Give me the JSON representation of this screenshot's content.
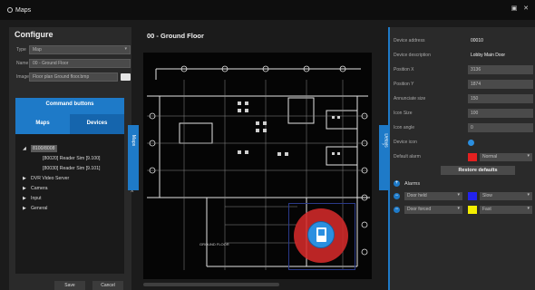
{
  "window": {
    "title": "Maps",
    "controls": [
      "restore-icon",
      "close-icon"
    ]
  },
  "configure": {
    "title": "Configure",
    "fields": [
      {
        "label": "Type",
        "value": "Map"
      },
      {
        "label": "Name",
        "value": "00 - Ground Floor"
      },
      {
        "label": "Image",
        "value": "Floor plan Ground floor.bmp"
      }
    ],
    "command_buttons_title": "Command buttons",
    "tabs": [
      "Maps",
      "Devices"
    ],
    "active_tab": "Devices",
    "tree": [
      {
        "label": "8100/8008",
        "level": 0,
        "expanded": true,
        "selected": true
      },
      {
        "label": "[80020] Reader Sim [9.100]",
        "level": 1
      },
      {
        "label": "[80030] Reader Sim [9.101]",
        "level": 1
      },
      {
        "label": "DVR Video Server",
        "level": 0,
        "expanded": false
      },
      {
        "label": "Camera",
        "level": 0,
        "expanded": false
      },
      {
        "label": "Input",
        "level": 0,
        "expanded": false
      },
      {
        "label": "General",
        "level": 0,
        "expanded": false
      }
    ],
    "save_label": "Save",
    "cancel_label": "Cancel",
    "maps_tab_label": "Maps"
  },
  "map": {
    "title": "00 - Ground Floor",
    "room_label": "GROUND FLOOR"
  },
  "details": {
    "tab_label": "Details",
    "rows": [
      {
        "label": "Device address",
        "value": "00010"
      },
      {
        "label": "Device description",
        "value": "Lobby Main Door"
      },
      {
        "label": "Position X",
        "value": "3136"
      },
      {
        "label": "Position Y",
        "value": "1874"
      },
      {
        "label": "Annunciate size",
        "value": "150"
      },
      {
        "label": "Icon Size",
        "value": "100"
      },
      {
        "label": "Icon angle",
        "value": "0"
      },
      {
        "label": "Device icon",
        "value": ""
      },
      {
        "label": "Default alarm",
        "value": "Normal"
      }
    ],
    "default_alarm_color": "#e32020",
    "restore_label": "Restore defaults",
    "alarms_label": "Alarms",
    "alarms": [
      {
        "name": "Door held",
        "color": "#2222ee",
        "mode": "Slow"
      },
      {
        "name": "Door forced",
        "color": "#f4ee00",
        "mode": "Fast"
      }
    ]
  },
  "colors": {
    "accent": "#1e7ac8",
    "alarm_red": "#d42a2a",
    "device_blue": "#2b8fe0"
  }
}
